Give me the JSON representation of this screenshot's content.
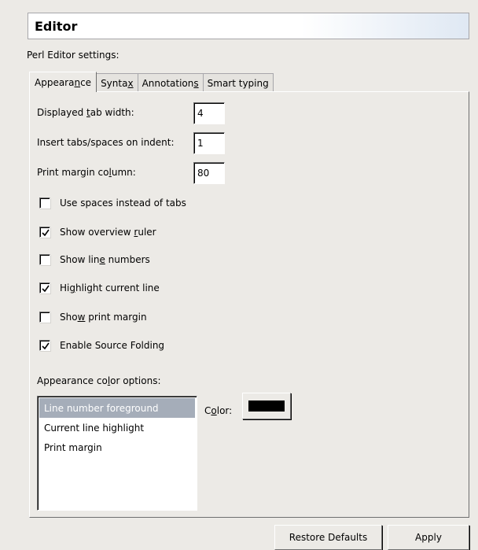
{
  "header": {
    "title": "Editor"
  },
  "subtitle": "Perl Editor settings:",
  "tabs": [
    {
      "pre": "Appeara",
      "mn": "n",
      "post": "ce"
    },
    {
      "pre": "Synta",
      "mn": "x",
      "post": ""
    },
    {
      "pre": "Annotation",
      "mn": "s",
      "post": ""
    },
    {
      "pre": "Smart typing",
      "mn": "",
      "post": ""
    }
  ],
  "fields": [
    {
      "pre": "Displayed ",
      "mn": "t",
      "post": "ab width:",
      "value": "4"
    },
    {
      "pre": "Insert tabs/spaces on indent:",
      "mn": "",
      "post": "",
      "value": "1"
    },
    {
      "pre": "Print margin co",
      "mn": "l",
      "post": "umn:",
      "value": "80"
    }
  ],
  "checkboxes": [
    {
      "pre": "Use spaces instead of tabs",
      "mn": "",
      "post": "",
      "checked": false
    },
    {
      "pre": "Show overview ",
      "mn": "r",
      "post": "uler",
      "checked": true
    },
    {
      "pre": "Show lin",
      "mn": "e",
      "post": " numbers",
      "checked": false
    },
    {
      "pre": "Hi",
      "mn": "g",
      "post": "hlight current line",
      "checked": true
    },
    {
      "pre": "Sho",
      "mn": "w",
      "post": " print margin",
      "checked": false
    },
    {
      "pre": "Enable Source Folding",
      "mn": "",
      "post": "",
      "checked": true
    }
  ],
  "color_options": {
    "label_pre": "Appearance co",
    "label_mn": "l",
    "label_post": "or options:",
    "items": [
      "Line number foreground",
      "Current line highlight",
      "Print margin"
    ],
    "color_pre": "C",
    "color_mn": "o",
    "color_post": "lor:",
    "swatch": "#000000"
  },
  "buttons": {
    "restore": "Restore Defaults",
    "apply": "Apply"
  }
}
